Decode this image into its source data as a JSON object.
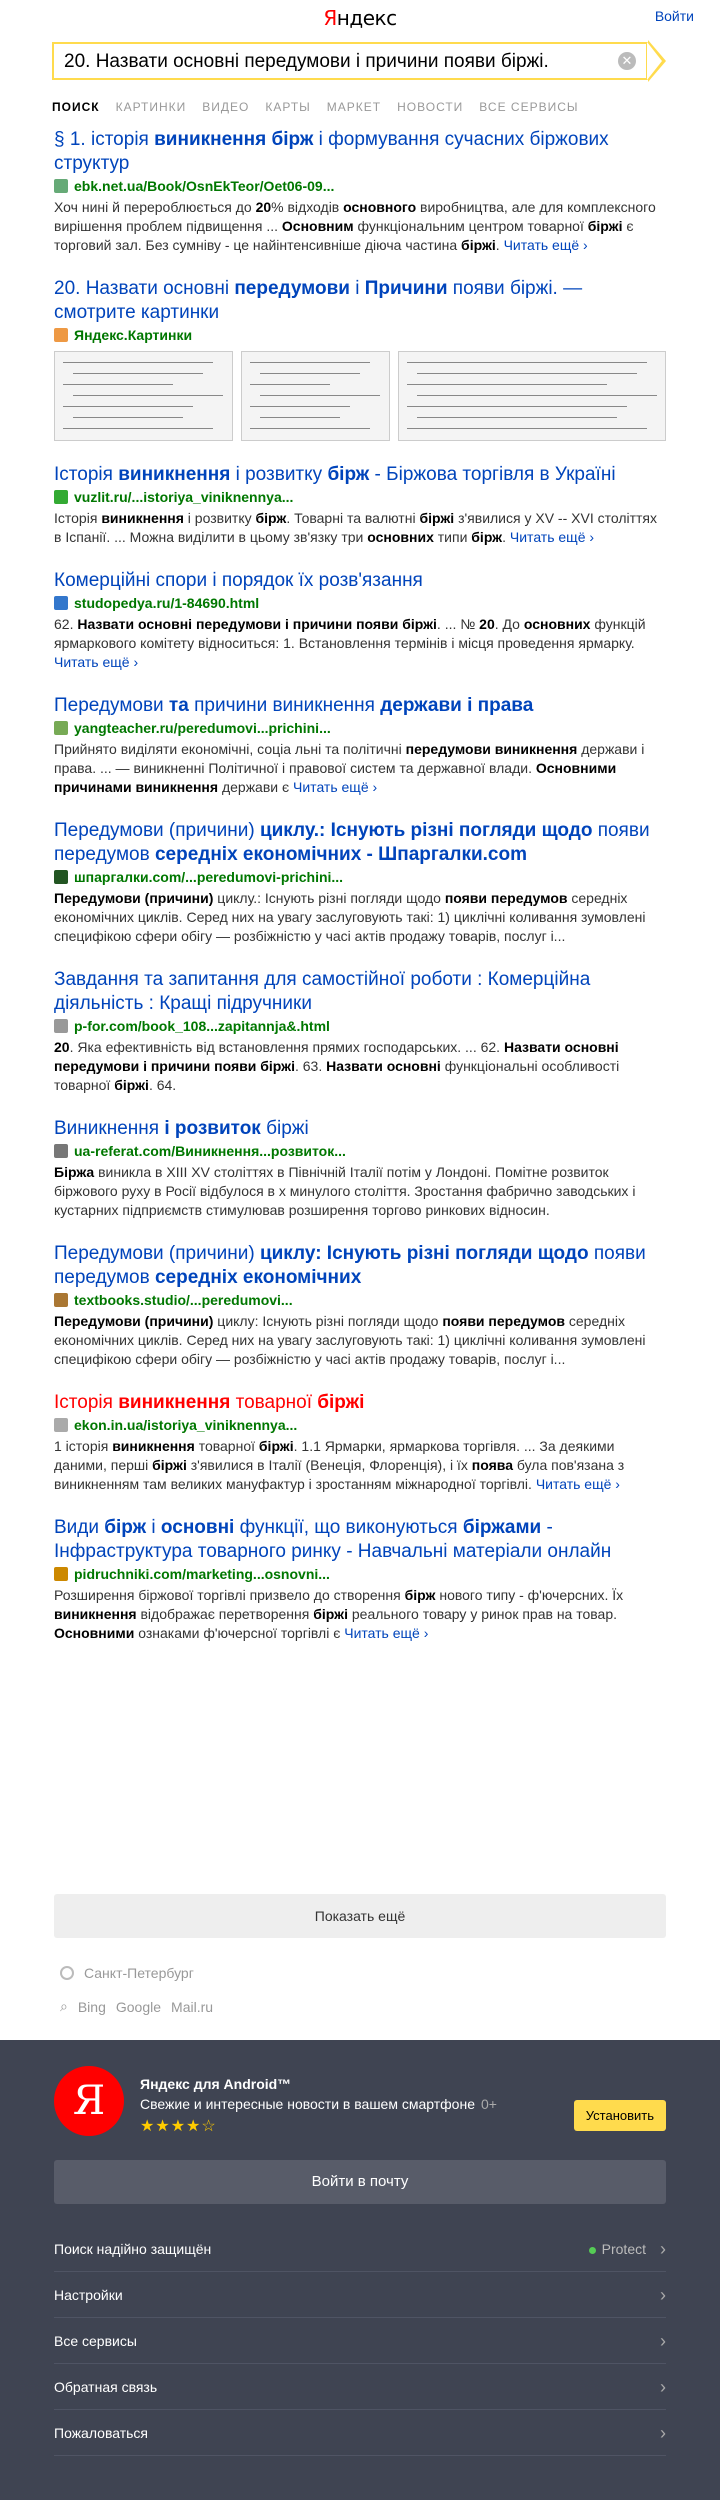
{
  "header": {
    "logo": "Яндекс",
    "login": "Войти"
  },
  "search": {
    "query": "20. Назвати основні передумови і причини появи біржі."
  },
  "nav": [
    "ПОИСК",
    "КАРТИНКИ",
    "ВИДЕО",
    "КАРТЫ",
    "МАРКЕТ",
    "НОВОСТИ",
    "ВСЕ СЕРВИСЫ"
  ],
  "results": [
    {
      "title_parts": [
        "§ 1. історія ",
        "виникнення бірж",
        " і формування сучасних біржових структур"
      ],
      "url": "ebk.net.ua/Book/OsnEkTeor/Oet06-09...",
      "snippet_html": "Хоч нині й перероблюється до <b>20</b>% відходів <b>основного</b> виробництва, але для комплексного вирішення проблем підвищення ... <b>Основним</b> функціональним центром товарної <b>біржі</b> є торговий зал. Без сумніву - це найінтенсивніше діюча частина <b>біржі</b>.",
      "more": "Читать ещё ›"
    },
    {
      "title_parts": [
        "20. Назвати основні ",
        "передумови",
        " і ",
        "Причини",
        " появи біржі. — смотрите картинки"
      ],
      "url": "Яндекс.Картинки",
      "images": true
    },
    {
      "title_parts": [
        "Історія ",
        "виникнення",
        " і розвитку ",
        "бірж",
        " - Біржова торгівля в Україні"
      ],
      "url": "vuzlit.ru/...istoriya_viniknennya...",
      "snippet_html": "Історія <b>виникнення</b> і розвитку <b>бірж</b>. Товарні та валютні <b>біржі</b> з'явилися у XV -- XVI століттях в Іспанії. ... Можна виділити в цьому зв'язку три <b>основних</b> типи <b>бірж</b>.",
      "more": "Читать ещё ›"
    },
    {
      "title_parts": [
        "Комерційні спори і порядок їх розв'язання"
      ],
      "url": "studopedya.ru/1-84690.html",
      "snippet_html": "62. <b>Назвати основні передумови і причини появи біржі</b>. ... № <b>20</b>. До <b>основних</b> функцій ярмаркового комітету відноситься: 1. Встановлення термінів і місця проведення ярмарку.",
      "more": "Читать ещё ›"
    },
    {
      "title_parts": [
        "Передумови",
        " та ",
        "причини виникнення",
        " держави і права"
      ],
      "url": "yangteacher.ru/peredumovi...prichini...",
      "snippet_html": "Прийнято виділяти економічні, соціа льні та політичні <b>передумови виникнення</b> держави і права. ... — виникненні Політичної і правової систем та державної влади. <b>Основними причинами виникнення</b> держави є",
      "more": "Читать ещё ›"
    },
    {
      "title_parts": [
        "Передумови (причини)",
        " циклу.: Існують різні погляди щодо ",
        "появи передумов",
        " середніх економічних - Шпаргалки.com"
      ],
      "url": "шпаргалки.com/...peredumovi-prichini...",
      "snippet_html": "<b>Передумови (причини)</b> циклу.: Існують різні погляди щодо <b>появи передумов</b> середніх економічних циклів. Серед них на увагу заслуговують такі: 1) циклічні коливання зумовлені специфікою сфери обігу — розбіжністю у часі актів продажу товарів, послуг і..."
    },
    {
      "title_parts": [
        "Завдання та запитання для самостійної роботи : Комерційна діяльність : Кращі підручники"
      ],
      "url": "p-for.com/book_108...zapitannja&.html",
      "snippet_html": "<b>20</b>. Яка ефективність від встановлення прямих господарських. ... 62. <b>Назвати основні передумови і причини появи біржі</b>. 63. <b>Назвати основні</b> функціональні особливості товарної <b>біржі</b>. 64."
    },
    {
      "title_parts": [
        "Виникнення",
        " і розвиток ",
        "біржі"
      ],
      "url": "ua-referat.com/Виникнення...розвиток...",
      "snippet_html": "<b>Біржа</b> виникла в XIII XV століттях в Північній Італії потім у Лондоні. Помітне розвиток біржового руху в Росії відбулося в х минулого століття. Зростання фабрично заводських і кустарних підприємств стимулював розширення торгово ринкових відносин."
    },
    {
      "title_parts": [
        "Передумови (причини)",
        " циклу: Існують різні погляди щодо ",
        "появи передумов",
        " середніх економічних"
      ],
      "url": "textbooks.studio/...peredumovi...",
      "snippet_html": "<b>Передумови (причини)</b> циклу: Існують різні погляди щодо <b>появи передумов</b> середніх економічних циклів. Серед них на увагу заслуговують такі: 1) циклічні коливання зумовлені специфікою сфери обігу — розбіжністю у часі актів продажу товарів, послуг і..."
    },
    {
      "title_parts": [
        "Історія ",
        "виникнення",
        " товарної ",
        "біржі"
      ],
      "visited": true,
      "url": "ekon.in.ua/istoriya_viniknennya...",
      "snippet_html": "1 історія <b>виникнення</b> товарної <b>біржі</b>. 1.1 Ярмарки, ярмаркова торгівля. ... За деякими даними, перші <b>біржі</b> з'явилися в Італії (Венеція, Флоренція), і їх <b>поява</b> була пов'язана з виникненням там великих мануфактур і зростанням міжнародної торгівлі.",
      "more": "Читать ещё ›"
    },
    {
      "title_parts": [
        "Види ",
        "бірж",
        " і ",
        "основні",
        " функції, що виконуються ",
        "біржами",
        " - Інфраструктура товарного ринку - Навчальні матеріали онлайн"
      ],
      "url": "pidruchniki.com/marketing...osnovni...",
      "snippet_html": "Розширення біржової торгівлі призвело до створення <b>бірж</b> нового типу - ф'ючерсних. Їх <b>виникнення</b> відображає перетворення <b>біржі</b> реального товару у ринок прав на товар. <b>Основними</b> ознаками ф'ючерсної торгівлі є",
      "more": "Читать ещё ›"
    }
  ],
  "show_more": "Показать ещё",
  "location": "Санкт-Петербург",
  "engines": [
    "Bing",
    "Google",
    "Mail.ru"
  ],
  "footer": {
    "app_name": "Яндекс для Android™",
    "app_desc": "Свежие и интересные новости в вашем смартфоне",
    "age": "0+",
    "rating": "★★★★☆",
    "install": "Установить",
    "login_btn": "Войти в почту",
    "rows": [
      "Поиск надійно защищён",
      "Настройки",
      "Все сервисы",
      "Обратная связь",
      "Пожаловаться"
    ],
    "protect": "Protect"
  },
  "colors": {
    "link": "#0044bb",
    "url": "#007700",
    "visited": "#ff0000",
    "accent": "#ffdb4d",
    "footer": "#3f4452"
  }
}
